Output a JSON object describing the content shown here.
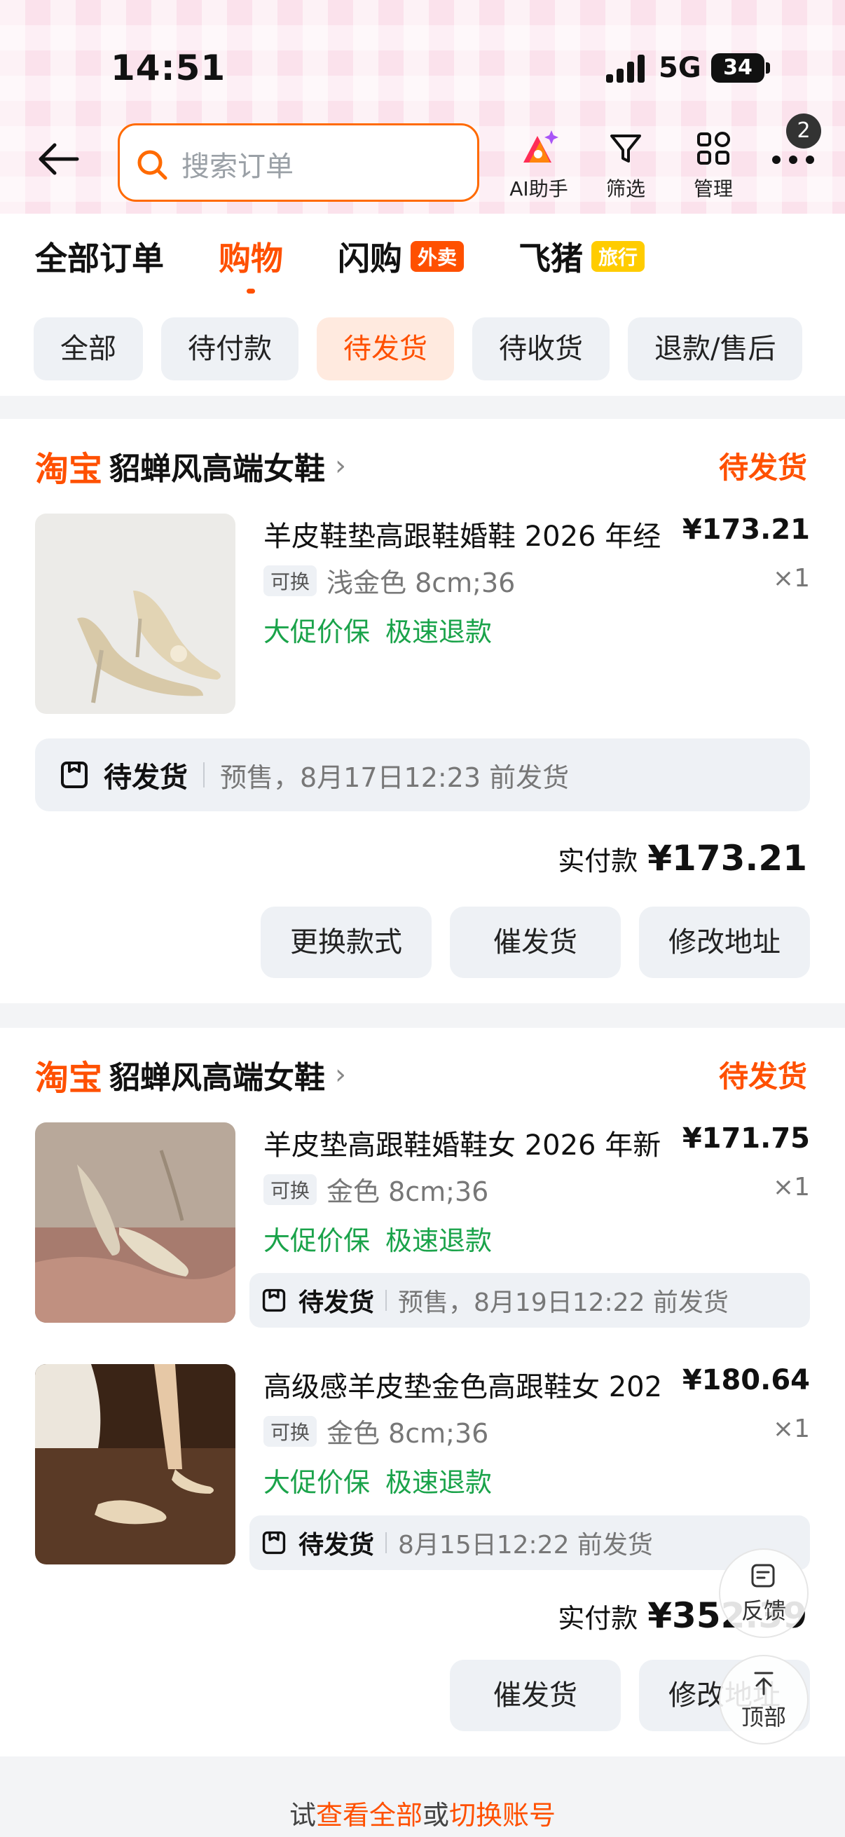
{
  "status_bar": {
    "time": "14:51",
    "network": "5G",
    "battery": "34"
  },
  "header": {
    "search_placeholder": "搜索订单",
    "tools": [
      {
        "label": "AI助手",
        "icon": "ai-assistant-icon"
      },
      {
        "label": "筛选",
        "icon": "filter-icon"
      },
      {
        "label": "管理",
        "icon": "grid-icon"
      }
    ],
    "more_badge": "2"
  },
  "tabs": [
    {
      "label": "全部订单"
    },
    {
      "label": "购物"
    },
    {
      "label": "闪购",
      "tag": "外卖"
    },
    {
      "label": "飞猪",
      "tag": "旅行"
    }
  ],
  "chips": [
    "全部",
    "待付款",
    "待发货",
    "待收货",
    "退款/售后"
  ],
  "orders": [
    {
      "platform": "淘宝",
      "shop": "貂蝉风高端女鞋",
      "status": "待发货",
      "items": [
        {
          "title": "羊皮鞋垫高跟鞋婚鞋 2026 年经",
          "price": "¥173.21",
          "swap_tag": "可换",
          "spec": "浅金色 8cm;36",
          "qty": "×1",
          "promos": [
            "大促价保",
            "极速退款"
          ]
        }
      ],
      "shipping": {
        "label": "待发货",
        "note": "预售，8月17日12:23 前发货"
      },
      "paid_label": "实付款",
      "paid_value": "¥173.21",
      "buttons": [
        "更换款式",
        "催发货",
        "修改地址"
      ]
    },
    {
      "platform": "淘宝",
      "shop": "貂蝉风高端女鞋",
      "status": "待发货",
      "items": [
        {
          "title": "羊皮垫高跟鞋婚鞋女 2026 年新",
          "price": "¥171.75",
          "swap_tag": "可换",
          "spec": "金色 8cm;36",
          "qty": "×1",
          "promos": [
            "大促价保",
            "极速退款"
          ],
          "shipping": {
            "label": "待发货",
            "note": "预售，8月19日12:22 前发货"
          }
        },
        {
          "title": "高级感羊皮垫金色高跟鞋女 202",
          "price": "¥180.64",
          "swap_tag": "可换",
          "spec": "金色 8cm;36",
          "qty": "×1",
          "promos": [
            "大促价保",
            "极速退款"
          ],
          "shipping": {
            "label": "待发货",
            "note": "8月15日12:22 前发货"
          }
        }
      ],
      "paid_label": "实付款",
      "paid_value": "¥352.39",
      "buttons": [
        "催发货",
        "修改地址"
      ]
    }
  ],
  "floating": {
    "feedback": "反馈",
    "top": "顶部"
  },
  "footer": {
    "prefix": "试",
    "link1": "查看全部",
    "mid": "或",
    "link2": "切换账号"
  },
  "colors": {
    "accent": "#ff5000",
    "promo": "#1aa34a",
    "chip_bg": "#eef1f5"
  }
}
